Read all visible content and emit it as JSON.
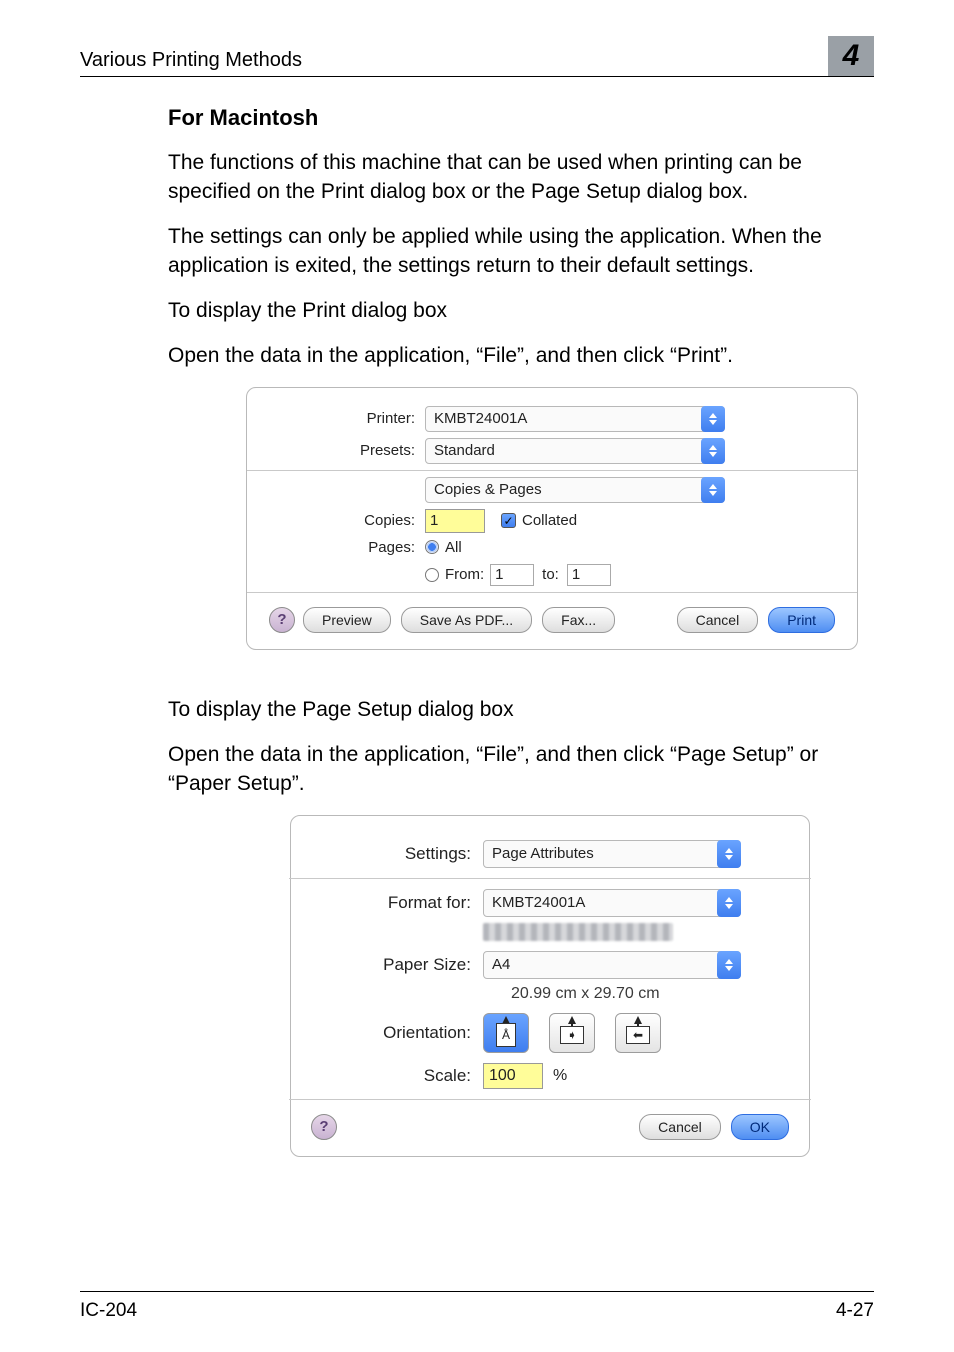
{
  "header": {
    "title": "Various Printing Methods",
    "chapter": "4"
  },
  "section": {
    "heading": "For Macintosh",
    "p1": "The functions of this machine that can be used when printing can be specified on the Print dialog box or the Page Setup dialog box.",
    "p2": "The settings can only be applied while using the application. When the application is exited, the settings return to their default settings.",
    "p3": "To display the Print dialog box",
    "p4": "Open the data in the application, “File”, and then click “Print”.",
    "p5": "To display the Page Setup dialog box",
    "p6": "Open the data in the application, “File”, and then click “Page Setup” or “Paper Setup”."
  },
  "print_dialog": {
    "labels": {
      "printer": "Printer:",
      "presets": "Presets:",
      "copies": "Copies:",
      "pages": "Pages:",
      "all": "All",
      "from": "From:",
      "to": "to:",
      "collated": "Collated"
    },
    "values": {
      "printer": "KMBT24001A",
      "presets": "Standard",
      "pane": "Copies & Pages",
      "copies": "1",
      "from_val": "1",
      "to_val": "1"
    },
    "buttons": {
      "help": "?",
      "preview": "Preview",
      "save_as_pdf": "Save As PDF...",
      "fax": "Fax...",
      "cancel": "Cancel",
      "print": "Print"
    }
  },
  "page_setup": {
    "labels": {
      "settings": "Settings:",
      "format_for": "Format for:",
      "paper_size": "Paper Size:",
      "orientation": "Orientation:",
      "scale": "Scale:",
      "percent": "%"
    },
    "values": {
      "settings": "Page Attributes",
      "format_for": "KMBT24001A",
      "paper_size": "A4",
      "dimensions": "20.99 cm x 29.70 cm",
      "scale": "100"
    },
    "buttons": {
      "help": "?",
      "cancel": "Cancel",
      "ok": "OK"
    },
    "orientation_glyphs": {
      "portrait": "Å",
      "landscape_right": "‣•",
      "landscape_left": "•€"
    }
  },
  "footer": {
    "left": "IC-204",
    "right": "4-27"
  }
}
